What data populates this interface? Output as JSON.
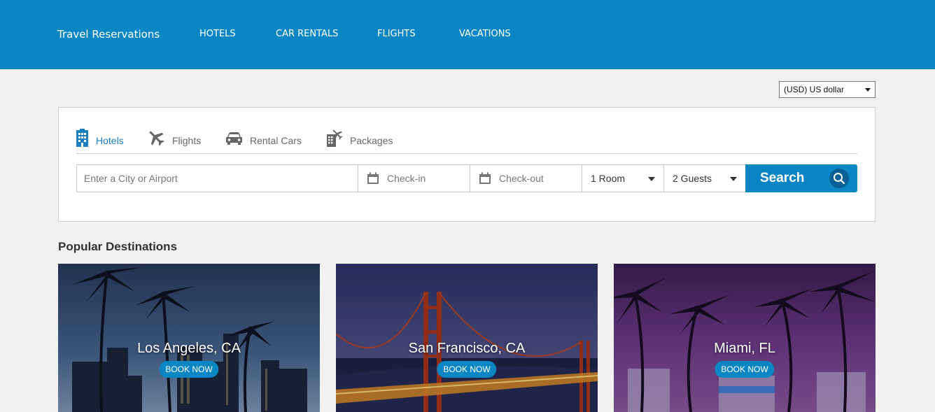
{
  "header": {
    "brand": "Travel Reservations",
    "nav": [
      "HOTELS",
      "CAR RENTALS",
      "FLIGHTS",
      "VACATIONS"
    ]
  },
  "currency": {
    "selected": "(USD) US dollar"
  },
  "search": {
    "tabs": [
      {
        "label": "Hotels",
        "icon": "hotel-icon",
        "active": true
      },
      {
        "label": "Flights",
        "icon": "plane-icon",
        "active": false
      },
      {
        "label": "Rental Cars",
        "icon": "car-icon",
        "active": false
      },
      {
        "label": "Packages",
        "icon": "package-icon",
        "active": false
      }
    ],
    "destination_placeholder": "Enter a City or Airport",
    "checkin_placeholder": "Check-in",
    "checkout_placeholder": "Check-out",
    "rooms": "1 Room",
    "guests": "2 Guests",
    "button": "Search"
  },
  "popular": {
    "title": "Popular Destinations",
    "cards": [
      {
        "city": "Los Angeles, CA",
        "cta": "BOOK NOW"
      },
      {
        "city": "San Francisco, CA",
        "cta": "BOOK NOW"
      },
      {
        "city": "Miami, FL",
        "cta": "BOOK NOW"
      }
    ]
  },
  "colors": {
    "primary": "#0b86c5",
    "background": "#f1f1f1",
    "tab_active": "#1a7fc1"
  }
}
